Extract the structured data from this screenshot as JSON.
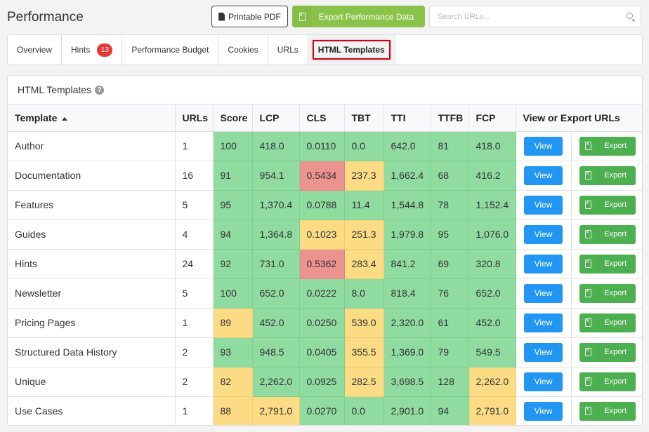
{
  "header": {
    "title": "Performance",
    "pdf_button": "Printable PDF",
    "export_button": "Export Performance Data",
    "search_placeholder": "Search URLs..."
  },
  "tabs": [
    {
      "label": "Overview",
      "active": false
    },
    {
      "label": "Hints",
      "badge": "13",
      "active": false
    },
    {
      "label": "Performance Budget",
      "active": false
    },
    {
      "label": "Cookies",
      "active": false
    },
    {
      "label": "URLs",
      "active": false
    },
    {
      "label": "HTML Templates",
      "active": true
    }
  ],
  "panel": {
    "title": "HTML Templates",
    "help_icon": "?",
    "columns": [
      "Template",
      "URLs",
      "Score",
      "LCP",
      "CLS",
      "TBT",
      "TTI",
      "TTFB",
      "FCP",
      "View or Export URLs"
    ],
    "sort": {
      "column": "Template",
      "direction": "asc"
    },
    "view_label": "View",
    "export_label": "Export",
    "status_colors": {
      "good": "#8fdba0",
      "warn": "#fbdc84",
      "bad": "#ec9390"
    },
    "rows": [
      {
        "template": "Author",
        "urls": "1",
        "metrics": [
          [
            "100",
            "good"
          ],
          [
            "418.0",
            "good"
          ],
          [
            "0.0110",
            "good"
          ],
          [
            "0.0",
            "good"
          ],
          [
            "642.0",
            "good"
          ],
          [
            "81",
            "good"
          ],
          [
            "418.0",
            "good"
          ]
        ]
      },
      {
        "template": "Documentation",
        "urls": "16",
        "metrics": [
          [
            "91",
            "good"
          ],
          [
            "954.1",
            "good"
          ],
          [
            "0.5434",
            "bad"
          ],
          [
            "237.3",
            "warn"
          ],
          [
            "1,662.4",
            "good"
          ],
          [
            "68",
            "good"
          ],
          [
            "416.2",
            "good"
          ]
        ]
      },
      {
        "template": "Features",
        "urls": "5",
        "metrics": [
          [
            "95",
            "good"
          ],
          [
            "1,370.4",
            "good"
          ],
          [
            "0.0788",
            "good"
          ],
          [
            "11.4",
            "good"
          ],
          [
            "1,544.8",
            "good"
          ],
          [
            "78",
            "good"
          ],
          [
            "1,152.4",
            "good"
          ]
        ]
      },
      {
        "template": "Guides",
        "urls": "4",
        "metrics": [
          [
            "94",
            "good"
          ],
          [
            "1,364.8",
            "good"
          ],
          [
            "0.1023",
            "warn"
          ],
          [
            "251.3",
            "warn"
          ],
          [
            "1,979.8",
            "good"
          ],
          [
            "95",
            "good"
          ],
          [
            "1,076.0",
            "good"
          ]
        ]
      },
      {
        "template": "Hints",
        "urls": "24",
        "metrics": [
          [
            "92",
            "good"
          ],
          [
            "731.0",
            "good"
          ],
          [
            "0.5362",
            "bad"
          ],
          [
            "283.4",
            "warn"
          ],
          [
            "841.2",
            "good"
          ],
          [
            "69",
            "good"
          ],
          [
            "320.8",
            "good"
          ]
        ]
      },
      {
        "template": "Newsletter",
        "urls": "5",
        "metrics": [
          [
            "100",
            "good"
          ],
          [
            "652.0",
            "good"
          ],
          [
            "0.0222",
            "good"
          ],
          [
            "8.0",
            "good"
          ],
          [
            "818.4",
            "good"
          ],
          [
            "76",
            "good"
          ],
          [
            "652.0",
            "good"
          ]
        ]
      },
      {
        "template": "Pricing Pages",
        "urls": "1",
        "metrics": [
          [
            "89",
            "warn"
          ],
          [
            "452.0",
            "good"
          ],
          [
            "0.0250",
            "good"
          ],
          [
            "539.0",
            "warn"
          ],
          [
            "2,320.0",
            "good"
          ],
          [
            "61",
            "good"
          ],
          [
            "452.0",
            "good"
          ]
        ]
      },
      {
        "template": "Structured Data History",
        "urls": "2",
        "metrics": [
          [
            "93",
            "good"
          ],
          [
            "948.5",
            "good"
          ],
          [
            "0.0405",
            "good"
          ],
          [
            "355.5",
            "warn"
          ],
          [
            "1,369.0",
            "good"
          ],
          [
            "79",
            "good"
          ],
          [
            "549.5",
            "good"
          ]
        ]
      },
      {
        "template": "Unique",
        "urls": "2",
        "metrics": [
          [
            "82",
            "warn"
          ],
          [
            "2,262.0",
            "good"
          ],
          [
            "0.0925",
            "good"
          ],
          [
            "282.5",
            "warn"
          ],
          [
            "3,698.5",
            "good"
          ],
          [
            "128",
            "good"
          ],
          [
            "2,262.0",
            "warn"
          ]
        ]
      },
      {
        "template": "Use Cases",
        "urls": "1",
        "metrics": [
          [
            "88",
            "warn"
          ],
          [
            "2,791.0",
            "warn"
          ],
          [
            "0.0270",
            "good"
          ],
          [
            "0.0",
            "good"
          ],
          [
            "2,901.0",
            "good"
          ],
          [
            "94",
            "good"
          ],
          [
            "2,791.0",
            "warn"
          ]
        ]
      }
    ]
  }
}
